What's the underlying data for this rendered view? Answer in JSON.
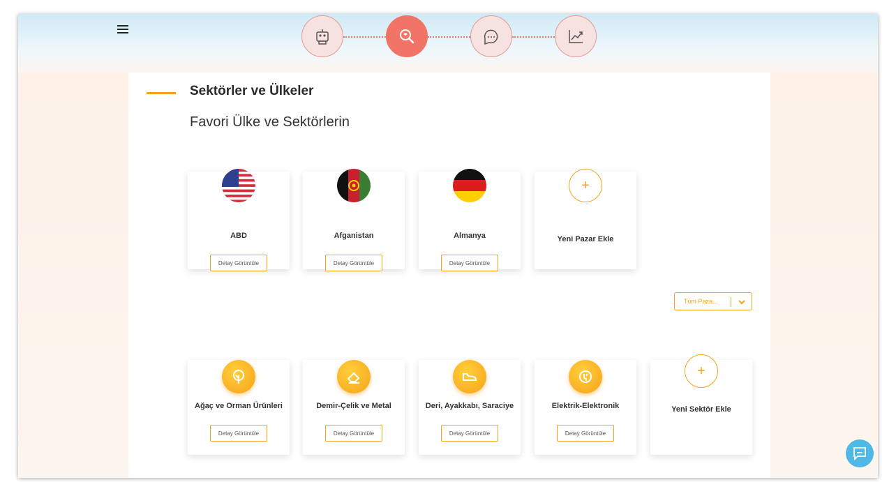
{
  "header": {
    "steps": [
      {
        "icon": "robot-icon",
        "active": false
      },
      {
        "icon": "search-box-icon",
        "active": true
      },
      {
        "icon": "chat-bubble-icon",
        "active": false
      },
      {
        "icon": "trend-chart-icon",
        "active": false
      }
    ]
  },
  "page": {
    "title": "Sektörler ve Ülkeler",
    "subtitle": "Favori Ülke ve Sektörlerin"
  },
  "markets": [
    {
      "name": "ABD",
      "button": "Detay Görüntüle",
      "icon": "usa-flag-icon"
    },
    {
      "name": "Afganistan",
      "button": "Detay Görüntüle",
      "icon": "afghanistan-flag-icon"
    },
    {
      "name": "Almanya",
      "button": "Detay Görüntüle",
      "icon": "germany-flag-icon"
    },
    {
      "name": "Yeni Pazar Ekle",
      "icon": "plus-icon"
    }
  ],
  "filter": {
    "selected": "Tüm Paza..."
  },
  "sectors": [
    {
      "name": "Ağaç ve Orman Ürünleri",
      "button": "Detay Görüntüle",
      "icon": "tree-icon"
    },
    {
      "name": "Demir-Çelik ve Metal",
      "button": "Detay Görüntüle",
      "icon": "metal-eraser-icon"
    },
    {
      "name": "Deri, Ayakkabı, Saraciye",
      "button": "Detay Görüntüle",
      "icon": "shoe-icon"
    },
    {
      "name": "Elektrik-Elektronik",
      "button": "Detay Görüntüle",
      "icon": "power-plug-icon"
    },
    {
      "name": "Yeni Sektör Ekle",
      "icon": "plus-icon"
    }
  ],
  "colors": {
    "accent": "#f7a21b",
    "step_active": "#f27466",
    "chat": "#4fb8e6"
  }
}
